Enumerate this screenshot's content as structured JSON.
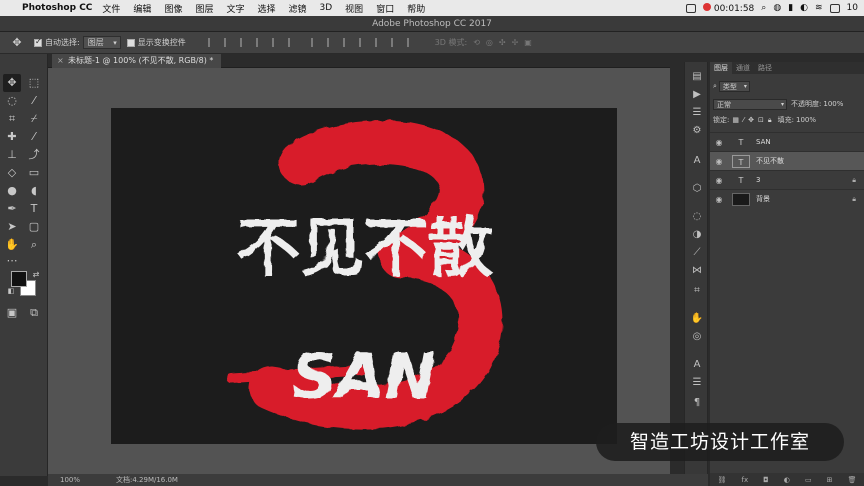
{
  "menubar": {
    "app_name": "Photoshop CC",
    "items": [
      "文件",
      "编辑",
      "图像",
      "图层",
      "文字",
      "选择",
      "滤镜",
      "3D",
      "视图",
      "窗口",
      "帮助"
    ],
    "timer": "00:01:58",
    "time": "10"
  },
  "window": {
    "title": "Adobe Photoshop CC 2017"
  },
  "options": {
    "auto_select_label": "自动选择:",
    "auto_select_value": "图层",
    "show_transform_label": "显示变换控件",
    "mode_3d_label": "3D 模式:"
  },
  "document": {
    "tab_title": "未标题-1 @ 100% (不见不散, RGB/8) *",
    "zoom": "100%",
    "doc_info": "文档:4.29M/16.0M",
    "art": {
      "headline": "不见不散",
      "sub": "SAN",
      "numeral": "3",
      "accent_color": "#d81f2a",
      "text_color": "#eeeeee",
      "canvas_color": "#1c1c1c"
    }
  },
  "layers_panel": {
    "tabs": [
      "图层",
      "通道",
      "路径"
    ],
    "filter_label": "类型",
    "blend_mode": "正常",
    "opacity_label": "不透明度:",
    "opacity_value": "100%",
    "lock_label": "锁定:",
    "fill_label": "填充:",
    "fill_value": "100%",
    "layers": [
      {
        "name": "SAN",
        "kind": "text",
        "selected": false,
        "locked": false
      },
      {
        "name": "不见不散",
        "kind": "text",
        "selected": true,
        "locked": false
      },
      {
        "name": "3",
        "kind": "text",
        "selected": false,
        "locked": true
      },
      {
        "name": "背景",
        "kind": "fill",
        "selected": false,
        "locked": true
      }
    ]
  },
  "watermark": "智造工坊设计工作室"
}
